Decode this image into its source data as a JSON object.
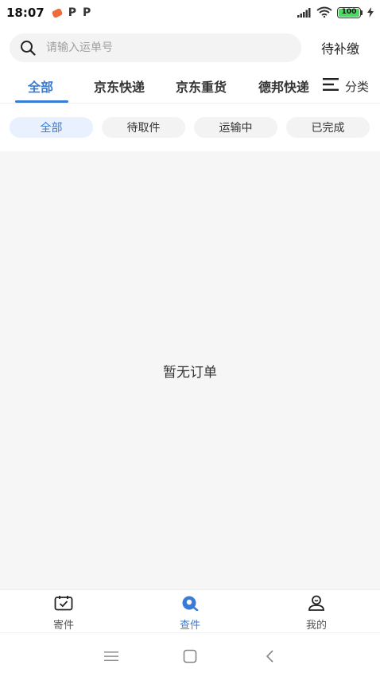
{
  "status_bar": {
    "time": "18:07",
    "notification_letters": [
      "P",
      "P"
    ],
    "battery": "100"
  },
  "search": {
    "placeholder": "请输入运单号",
    "pending_payment_label": "待补缴"
  },
  "category_tabs": [
    {
      "label": "全部",
      "active": true
    },
    {
      "label": "京东快递",
      "active": false
    },
    {
      "label": "京东重货",
      "active": false
    },
    {
      "label": "德邦快递",
      "active": false
    }
  ],
  "classify_label": "分类",
  "filter_chips": [
    {
      "label": "全部",
      "active": true
    },
    {
      "label": "待取件",
      "active": false
    },
    {
      "label": "运输中",
      "active": false
    },
    {
      "label": "已完成",
      "active": false
    }
  ],
  "empty_state": "暂无订单",
  "bottom_nav": [
    {
      "label": "寄件",
      "icon": "send-package-icon",
      "active": false
    },
    {
      "label": "查件",
      "icon": "track-package-icon",
      "active": true
    },
    {
      "label": "我的",
      "icon": "profile-icon",
      "active": false
    }
  ],
  "system_nav": [
    "menu-icon",
    "home-icon",
    "back-icon"
  ],
  "colors": {
    "accent": "#3a7bd5",
    "chip_active_bg": "#e8f1fd",
    "content_bg": "#f6f6f6"
  }
}
